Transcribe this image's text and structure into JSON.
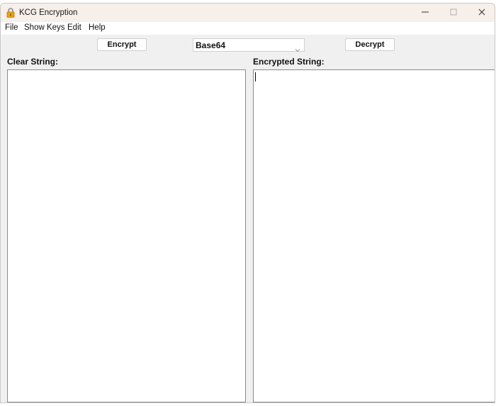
{
  "window": {
    "title": "KCG Encryption",
    "controls": {
      "minimize_glyph": "—",
      "maximize_glyph": "☐",
      "close_glyph": "✕"
    },
    "icon": "padlock-icon"
  },
  "menu": {
    "items": [
      "File",
      "Show Keys",
      "Edit",
      "Help"
    ]
  },
  "toolbar": {
    "encrypt_label": "Encrypt",
    "decrypt_label": "Decrypt",
    "method_select": {
      "value": "Base64"
    }
  },
  "panels": {
    "clear_label": "Clear String:",
    "clear_value": "",
    "encrypted_label": "Encrypted String:",
    "encrypted_value": ""
  },
  "colors": {
    "titlebar": "#f6efea",
    "window_bg": "#f0f0f0",
    "padlock": "#e8a317"
  }
}
